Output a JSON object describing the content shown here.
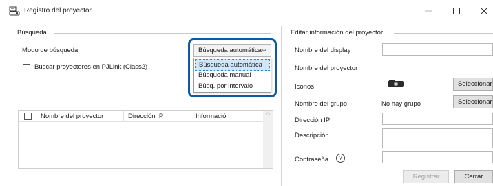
{
  "window": {
    "title": "Registro del proyector",
    "icon": "projector-register-icon"
  },
  "search": {
    "section_title": "Búsqueda",
    "mode_label": "Modo de búsqueda",
    "mode_value": "Búsqueda automática",
    "mode_options": [
      "Búsqueda automática",
      "Búsqueda manual",
      "Búsq. por intervalo"
    ],
    "pjlink_label": "Buscar proyectores en PJLink (Class2)",
    "pjlink_checked": false
  },
  "table": {
    "headers": [
      "Nombre del proyector",
      "Dirección IP",
      "Información"
    ],
    "rows": []
  },
  "edit": {
    "section_title": "Editar información del proyector",
    "display_name_label": "Nombre del display",
    "display_name_value": "",
    "projector_name_label": "Nombre del proyector",
    "icons_label": "Iconos",
    "icons_icon": "projector-icon",
    "select_icon_button": "Seleccionar...",
    "group_label": "Nombre del grupo",
    "group_value": "No hay grupo",
    "select_group_button": "Seleccionar...",
    "ip_label": "Dirección IP",
    "ip_value": "",
    "description_label": "Descripción",
    "description_value": "",
    "password_label": "Contraseña",
    "password_help": "?",
    "password_value": ""
  },
  "footer": {
    "register_button": "Registrar",
    "close_button": "Cerrar"
  },
  "colors": {
    "highlight": "#0e5aa0",
    "selected_item": "#cce8ff"
  }
}
